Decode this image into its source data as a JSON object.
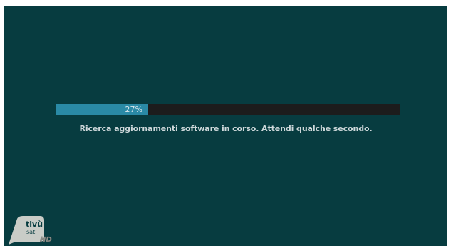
{
  "progress": {
    "value": 0.27,
    "label": "27%",
    "track_color": "#1c1c1c",
    "fill_color": "#2a8aa6"
  },
  "status": {
    "message": "Ricerca aggiornamenti software in corso.  Attendi qualche secondo."
  },
  "logo": {
    "name": "tivusat-hd-logo",
    "line1": "tivù",
    "line2": "sat",
    "badge": "HD"
  },
  "colors": {
    "background": "#073c40"
  }
}
